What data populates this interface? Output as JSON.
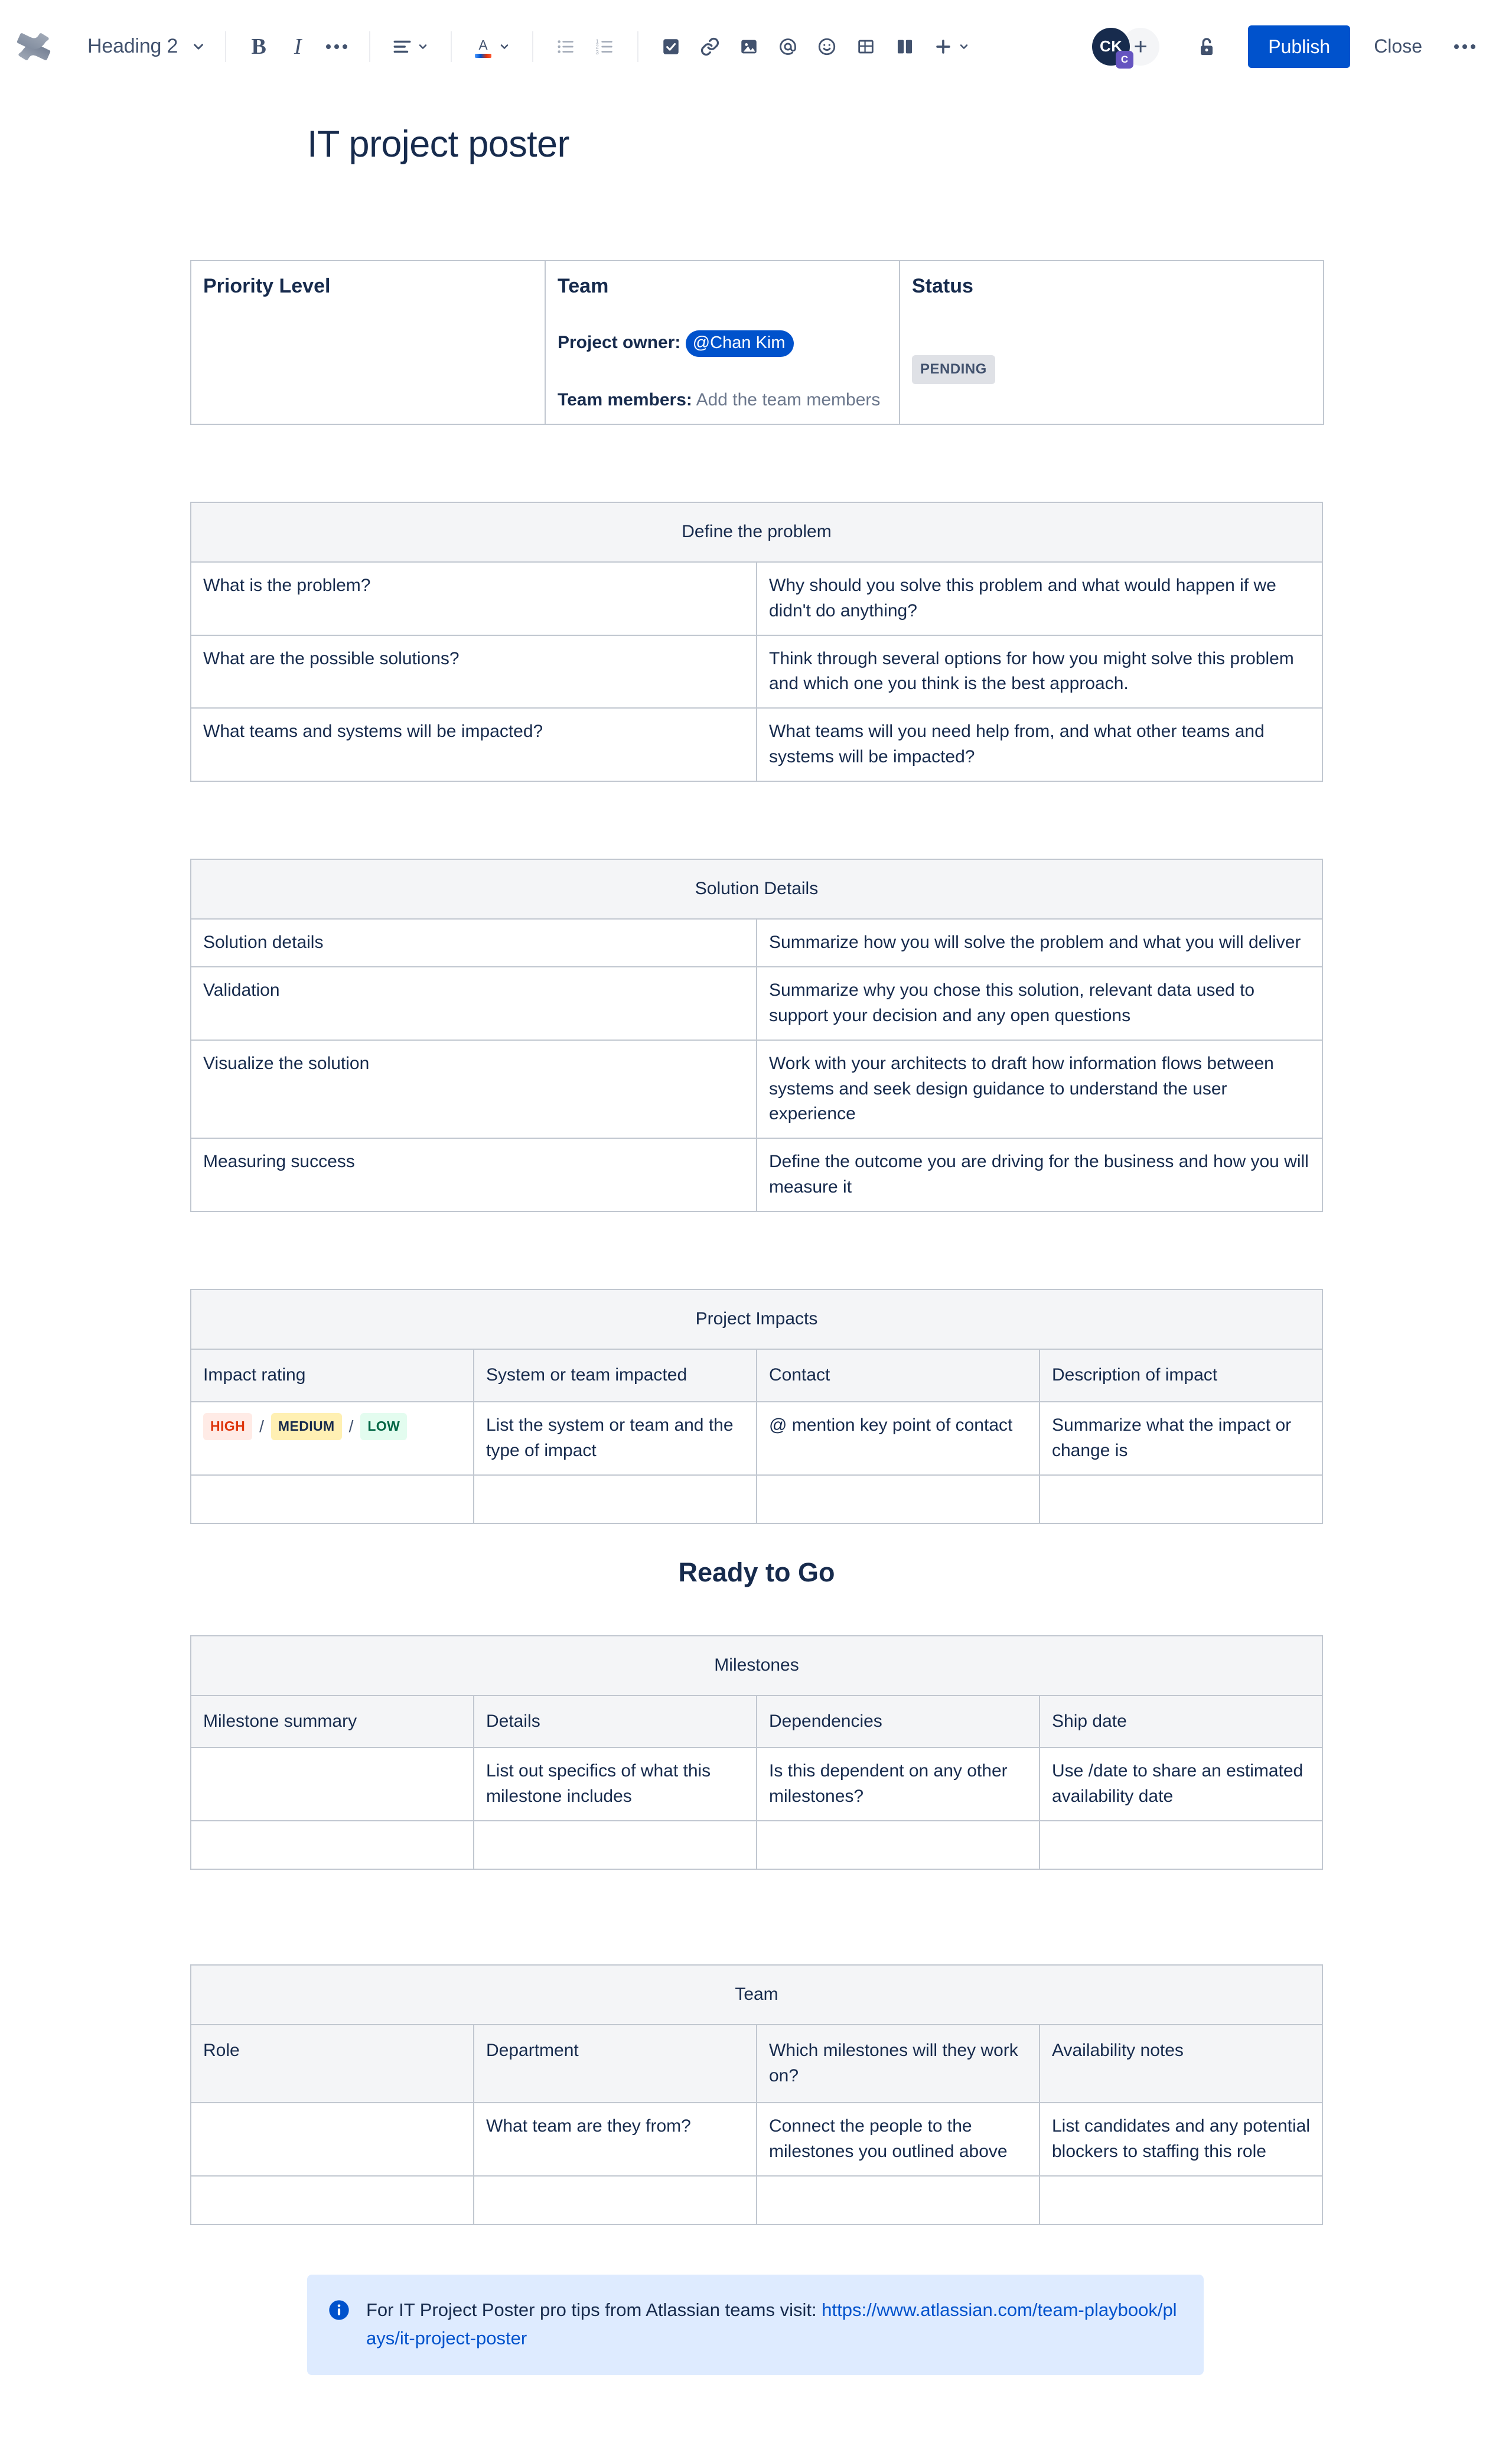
{
  "toolbar": {
    "logo_name": "confluence-logo",
    "block_type": "Heading 2",
    "bold_label": "B",
    "italic_label": "I",
    "more_formatting_label": "•••",
    "buttons": [
      {
        "name": "align-button",
        "label": "align"
      },
      {
        "name": "text-color-button",
        "label": "A"
      },
      {
        "name": "bullet-list-button",
        "label": "bullet list"
      },
      {
        "name": "numbered-list-button",
        "label": "numbered list"
      },
      {
        "name": "task-button",
        "label": "action item"
      },
      {
        "name": "link-button",
        "label": "link"
      },
      {
        "name": "image-button",
        "label": "image"
      },
      {
        "name": "mention-button",
        "label": "mention"
      },
      {
        "name": "emoji-button",
        "label": "emoji"
      },
      {
        "name": "table-button",
        "label": "table"
      },
      {
        "name": "layout-button",
        "label": "layouts"
      },
      {
        "name": "insert-more-button",
        "label": "insert"
      }
    ],
    "avatar_initials": "CK",
    "avatar_badge": "C",
    "add_people_label": "+",
    "publish_label": "Publish",
    "close_label": "Close",
    "more_label": "•••",
    "accent_color": "#0052CC",
    "badge_color": "#6554C0"
  },
  "page": {
    "title": "IT project poster"
  },
  "info_table": {
    "priority": {
      "heading": "Priority Level"
    },
    "team": {
      "heading": "Team",
      "owner_label": "Project owner:",
      "owner_mention": "@Chan Kim",
      "members_label": "Team members:",
      "members_placeholder": "Add the team members"
    },
    "status": {
      "heading": "Status",
      "lozenge": "PENDING"
    }
  },
  "define_problem": {
    "title": "Define the problem",
    "rows": [
      {
        "label": "What is the problem?",
        "value": "Why should you solve this problem and what would happen if we didn't do anything?"
      },
      {
        "label": "What are the possible solutions?",
        "value": "Think through several options for how you might solve this problem and which one you think is the best approach."
      },
      {
        "label": "What teams and systems will be impacted?",
        "value": "What teams will you need help from, and what other teams and systems will be impacted?"
      }
    ]
  },
  "solution_details": {
    "title": "Solution Details",
    "rows": [
      {
        "label": "Solution details",
        "value": "Summarize how you will solve the problem and what you will deliver"
      },
      {
        "label": "Validation",
        "value": "Summarize why you chose this solution, relevant data used to support your decision and any open questions"
      },
      {
        "label": "Visualize the solution",
        "value": "Work with your architects to draft how information flows between systems and seek design guidance to understand the user experience"
      },
      {
        "label": "Measuring success",
        "value": "Define the outcome you are driving for the business and how you will measure it"
      }
    ]
  },
  "project_impacts": {
    "title": "Project Impacts",
    "columns": [
      "Impact rating",
      "System or team impacted",
      "Contact",
      "Description of impact"
    ],
    "rating_options": [
      "HIGH",
      "MEDIUM",
      "LOW"
    ],
    "rating_separator": "/",
    "rating_colors": {
      "HIGH": "#DE350B",
      "MEDIUM": "#172B4D",
      "LOW": "#006644"
    },
    "row": {
      "system": "List the system or team and the type of impact",
      "contact": "@ mention key point of contact",
      "description": "Summarize what the impact or change is"
    }
  },
  "ready_to_go": {
    "heading": "Ready to Go"
  },
  "milestones": {
    "title": "Milestones",
    "columns": [
      "Milestone summary",
      "Details",
      "Dependencies",
      "Ship date"
    ],
    "row": {
      "summary": "",
      "details": "List out specifics of what this milestone includes",
      "dependencies": "Is this dependent on any other milestones?",
      "ship_date": "Use /date to share an estimated availability date"
    }
  },
  "team_table": {
    "title": "Team",
    "columns": [
      "Role",
      "Department",
      "Which milestones will they work on?",
      "Availability notes"
    ],
    "row": {
      "role": "",
      "department": "What team are they from?",
      "milestones": "Connect the people to the milestones you outlined above",
      "availability": "List candidates and any potential blockers to staffing this role"
    }
  },
  "info_panel": {
    "icon_name": "info-icon",
    "text": "For IT Project Poster pro tips from Atlassian teams visit:",
    "link": "https://www.atlassian.com/team-playbook/plays/it-project-poster",
    "background": "#DEEBFF"
  }
}
